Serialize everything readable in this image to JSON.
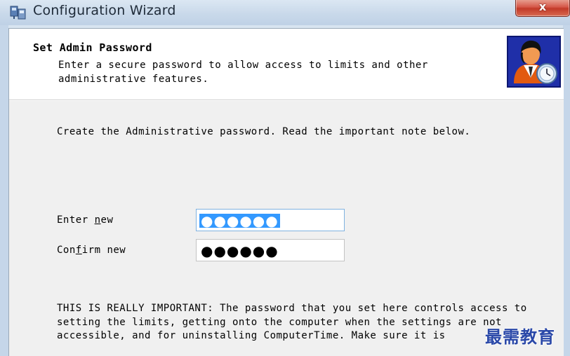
{
  "window": {
    "title": "Configuration Wizard",
    "close_glyph": "x"
  },
  "header": {
    "title": "Set Admin Password",
    "subtitle": "Enter a secure password to allow access to limits and other administrative features.",
    "icon": "admin-user-clock-icon"
  },
  "form": {
    "intro": "Create the Administrative password. Read the important note below.",
    "new_password": {
      "label_prefix": "Enter ",
      "label_mnemonic": "n",
      "label_suffix": "ew",
      "masked_value": "●●●●●●",
      "selected": true
    },
    "confirm_password": {
      "label_prefix": "Con",
      "label_mnemonic": "f",
      "label_suffix": "irm new",
      "masked_value": "●●●●●●",
      "selected": false
    }
  },
  "note": {
    "text": "THIS IS REALLY IMPORTANT: The password that you set here controls access to setting the limits, getting onto the computer when the settings are not accessible, and for uninstalling ComputerTime. Make sure it is"
  },
  "watermark": "最需教育",
  "colors": {
    "header_icon_bg": "#1f2fa8",
    "selection": "#3399ff",
    "focus_border": "#7fb2e0",
    "close_button": "#c23a28"
  }
}
